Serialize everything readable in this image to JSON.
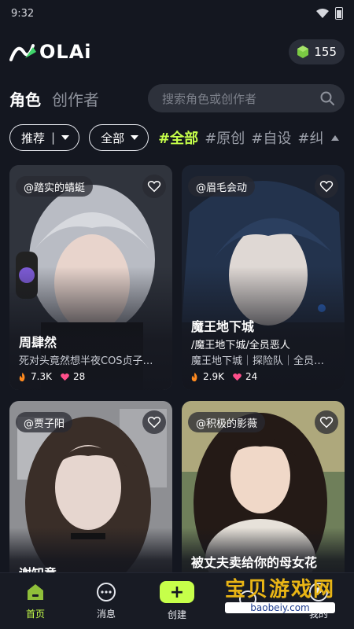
{
  "status_bar": {
    "time": "9:32"
  },
  "header": {
    "logo_text": "OLAi",
    "coin_count": "155"
  },
  "tabs": [
    {
      "label": "角色",
      "active": true
    },
    {
      "label": "创作者",
      "active": false
    }
  ],
  "search": {
    "placeholder": "搜索角色或创作者"
  },
  "filters": {
    "sort_label": "推荐",
    "gender_label": "全部",
    "hashtags": [
      {
        "label": "#全部",
        "active": true
      },
      {
        "label": "#原创",
        "active": false
      },
      {
        "label": "#自设",
        "active": false
      },
      {
        "label": "#纠",
        "active": false
      }
    ]
  },
  "cards": [
    {
      "creator": "@踏实的蜻蜓",
      "name": "周肆然",
      "desc": "死对头竟然想半夜COS贞子…",
      "desc2": "",
      "views": "7.3K",
      "likes": "28"
    },
    {
      "creator": "@眉毛会动",
      "name": "魔王地下城",
      "desc": "/魔王地下城/全员恶人",
      "desc2": "魔王地下城｜探险队｜全员…",
      "views": "2.9K",
      "likes": "24"
    },
    {
      "creator": "@贾子阳",
      "name": "谢知意",
      "desc": "",
      "desc2": "",
      "views": "",
      "likes": ""
    },
    {
      "creator": "@积极的影薇",
      "name": "被丈夫卖给你的母女花",
      "desc": "",
      "desc2": "",
      "views": "",
      "likes": ""
    }
  ],
  "bottom_nav": [
    {
      "label": "首页",
      "icon": "home-icon",
      "active": true
    },
    {
      "label": "消息",
      "icon": "message-icon",
      "active": false
    },
    {
      "label": "创建",
      "icon": "plus-icon",
      "active": false
    },
    {
      "label": "",
      "icon": "discover-icon",
      "active": false
    },
    {
      "label": "我的",
      "icon": "profile-icon",
      "active": false
    }
  ],
  "watermark": {
    "title": "宝贝游戏网",
    "url": "baobeiy.com"
  },
  "colors": {
    "accent": "#c6ff4a",
    "background": "#141720"
  }
}
